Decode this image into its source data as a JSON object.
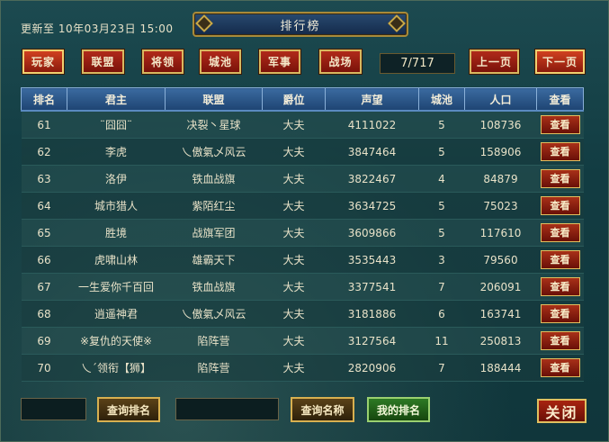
{
  "window": {
    "title": "排行榜",
    "update_time": "更新至 10年03月23日 15:00"
  },
  "tabs": [
    {
      "label": "玩家",
      "active": true
    },
    {
      "label": "联盟",
      "active": false
    },
    {
      "label": "将领",
      "active": false
    },
    {
      "label": "城池",
      "active": false
    },
    {
      "label": "军事",
      "active": false
    },
    {
      "label": "战场",
      "active": false
    }
  ],
  "pagination": {
    "page_indicator": "7/717",
    "prev_label": "上一页",
    "next_label": "下一页"
  },
  "table": {
    "columns": [
      "排名",
      "君主",
      "联盟",
      "爵位",
      "声望",
      "城池",
      "人口",
      "查看"
    ],
    "view_label": "查看",
    "rows": [
      [
        "61",
        "¨囧囧¨",
        "决裂丶星球",
        "大夫",
        "4111022",
        "5",
        "108736"
      ],
      [
        "62",
        "李虎",
        "乀傲氣乄风云",
        "大夫",
        "3847464",
        "5",
        "158906"
      ],
      [
        "63",
        "洛伊",
        "铁血战旗",
        "大夫",
        "3822467",
        "4",
        "84879"
      ],
      [
        "64",
        "城市猎人",
        "紫陌红尘",
        "大夫",
        "3634725",
        "5",
        "75023"
      ],
      [
        "65",
        "胜境",
        "战旗军团",
        "大夫",
        "3609866",
        "5",
        "117610"
      ],
      [
        "66",
        "虎啸山林",
        "雄霸天下",
        "大夫",
        "3535443",
        "3",
        "79560"
      ],
      [
        "67",
        "一生爱你千百回",
        "铁血战旗",
        "大夫",
        "3377541",
        "7",
        "206091"
      ],
      [
        "68",
        "逍遥神君",
        "乀傲氣乄风云",
        "大夫",
        "3181886",
        "6",
        "163741"
      ],
      [
        "69",
        "※复仇的天使※",
        "陷阵营",
        "大夫",
        "3127564",
        "11",
        "250813"
      ],
      [
        "70",
        "乀ˊ领衔【狮】",
        "陷阵营",
        "大夫",
        "2820906",
        "7",
        "188444"
      ]
    ]
  },
  "bottom": {
    "rank_query_label": "查询排名",
    "rank_query_value": "",
    "name_query_label": "查询名称",
    "name_query_value": "",
    "my_rank_label": "我的排名",
    "close_label": "关闭"
  },
  "colors": {
    "tab_red": "#b02a1a",
    "header_blue": "#3a6aa0",
    "gold_border": "#d8b860",
    "background_teal": "#123c42"
  }
}
